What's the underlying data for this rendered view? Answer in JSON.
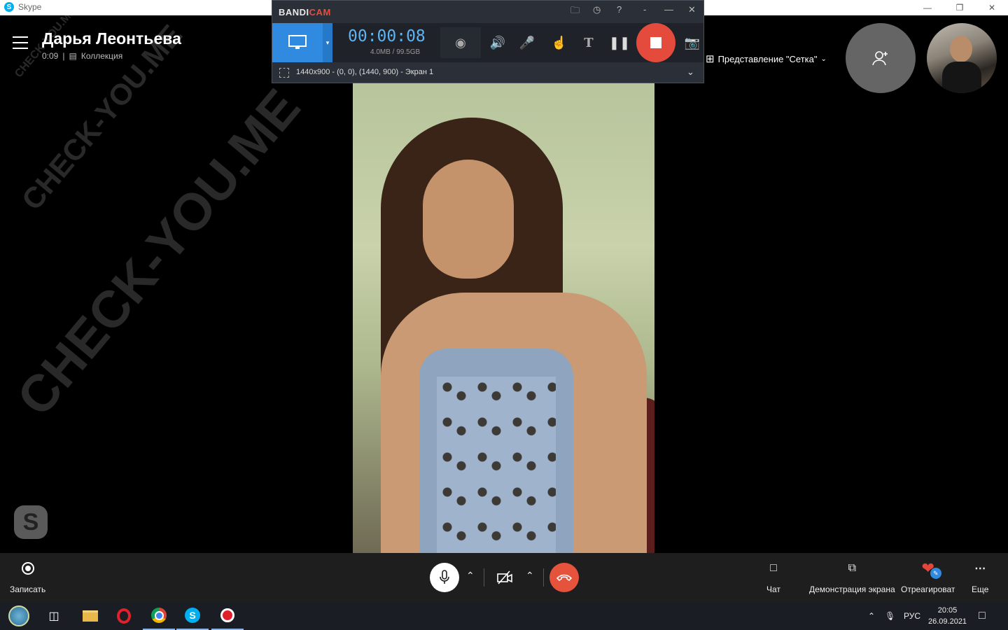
{
  "window": {
    "title": "Skype"
  },
  "call": {
    "name": "Дарья Леонтьева",
    "duration": "0:09",
    "gallery": "Коллекция"
  },
  "watermark": "CHECK-YOU.ME",
  "bandicam": {
    "logo_a": "BANDI",
    "logo_b": "CAM",
    "timer": "00:00:08",
    "size": "4.0MB / 99.5GB",
    "region": "1440x900 - (0, 0), (1440, 900) - Экран 1"
  },
  "view": {
    "grid_label": "Представление \"Сетка\""
  },
  "controls": {
    "record": "Записать",
    "chat": "Чат",
    "share": "Демонстрация экрана",
    "react": "Отреагироват",
    "more": "Еще"
  },
  "tray": {
    "lang": "РУС",
    "time": "20:05",
    "date": "26.09.2021"
  },
  "colors": {
    "accent": "#2f8ae0",
    "hangup": "#e5533d",
    "bandicam_bg": "#2b3038"
  }
}
